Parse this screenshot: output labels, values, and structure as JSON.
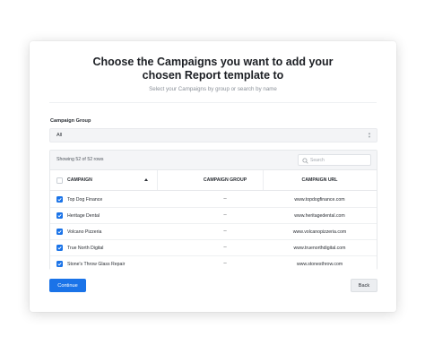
{
  "modal": {
    "title": "Choose the Campaigns you want to add your chosen Report template to",
    "subtitle": "Select your Campaigns by group or search by name"
  },
  "campaign_group": {
    "label": "Campaign Group",
    "selected": "All"
  },
  "table": {
    "showing_text": "Showing 52 of 52 rows",
    "search_placeholder": "Search",
    "columns": [
      "CAMPAIGN",
      "CAMPAIGN GROUP",
      "CAMPAIGN URL"
    ],
    "header_checkbox_checked": false,
    "sort_direction": "ascending",
    "rows": [
      {
        "name": "Top Dog Finance",
        "group": "--",
        "url": "www.topdogfinance.com",
        "checked": true
      },
      {
        "name": "Heritage Dental",
        "group": "--",
        "url": "www.heritagedental.com",
        "checked": true
      },
      {
        "name": "Volcano Pizzeria",
        "group": "--",
        "url": "www.volcanopizzeria.com",
        "checked": true
      },
      {
        "name": "True North Digital",
        "group": "--",
        "url": "www.truenorthdigital.com",
        "checked": true
      },
      {
        "name": "Stone's Throw Glass Repair",
        "group": "--",
        "url": "www.stonesthrow.com",
        "checked": true
      }
    ]
  },
  "buttons": {
    "continue_label": "Continue",
    "back_label": "Back"
  },
  "colors": {
    "accent": "#1a73e8",
    "text": "#1f2329",
    "muted": "#8b9199"
  }
}
